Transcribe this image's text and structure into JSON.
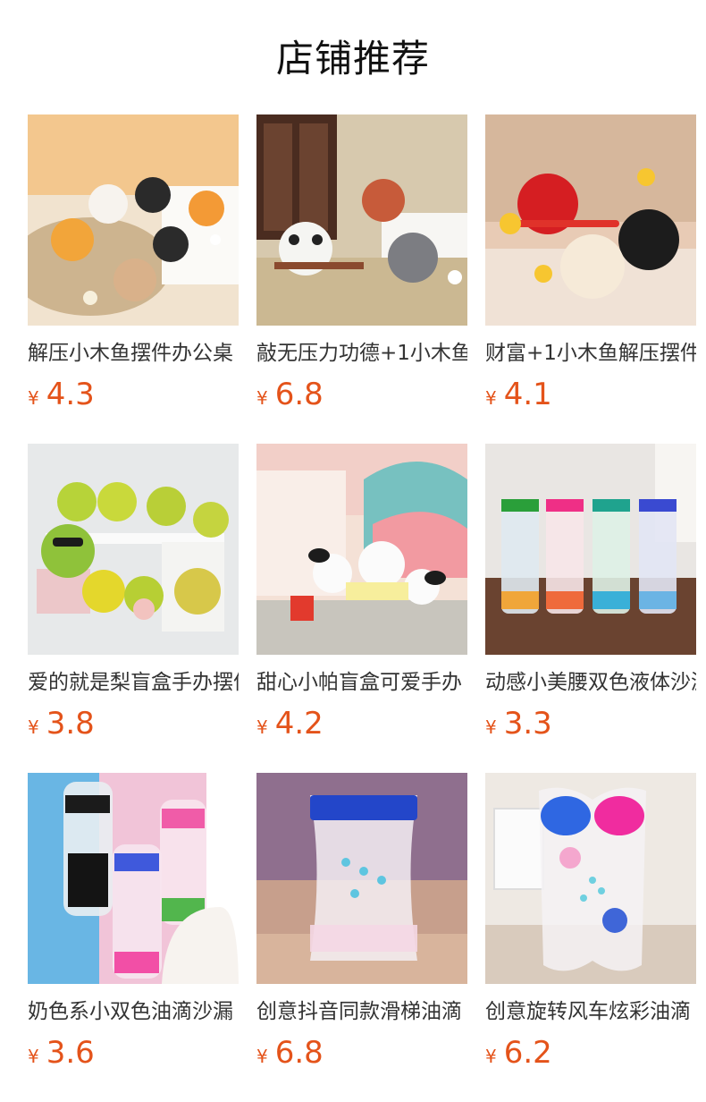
{
  "section": {
    "title": "店铺推荐"
  },
  "products": [
    {
      "name": "解压小木鱼摆件办公桌",
      "currency": "¥",
      "price": "4.3",
      "image": "cat-wooden-fish-figures"
    },
    {
      "name": "敲无压力功德+1小木鱼",
      "currency": "¥",
      "price": "6.8",
      "image": "panda-raccoon-wooden-fish"
    },
    {
      "name": "财富+1小木鱼解压摆件",
      "currency": "¥",
      "price": "4.1",
      "image": "lucky-cat-wooden-fish"
    },
    {
      "name": "爱的就是梨盲盒手办摆件",
      "currency": "¥",
      "price": "3.8",
      "image": "pear-blind-box-figures"
    },
    {
      "name": "甜心小帕盲盒可爱手办",
      "currency": "¥",
      "price": "4.2",
      "image": "pochacco-blind-box"
    },
    {
      "name": "动感小美腰双色液体沙漏",
      "currency": "¥",
      "price": "3.3",
      "image": "liquid-timers-colorful"
    },
    {
      "name": "奶色系小双色油滴沙漏",
      "currency": "¥",
      "price": "3.6",
      "image": "oil-drop-hourglass"
    },
    {
      "name": "创意抖音同款滑梯油滴",
      "currency": "¥",
      "price": "6.8",
      "image": "slide-oil-drop-timer"
    },
    {
      "name": "创意旋转风车炫彩油滴",
      "currency": "¥",
      "price": "6.2",
      "image": "windmill-oil-drop-timer"
    }
  ]
}
